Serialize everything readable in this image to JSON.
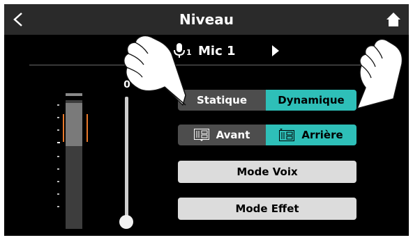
{
  "header": {
    "title": "Niveau",
    "back_icon": "chevron-left-icon",
    "home_icon": "home-icon"
  },
  "channel": {
    "number": "1",
    "label": "Mic 1",
    "icon": "microphone-icon",
    "next_icon": "triangle-right-icon"
  },
  "fader": {
    "value_label": "0",
    "level": 0
  },
  "meter": {
    "icon": "level-meter"
  },
  "mode_toggle": {
    "options": [
      "Statique",
      "Dynamique"
    ],
    "selected": "Dynamique"
  },
  "position_toggle": {
    "options": [
      "Avant",
      "Arrière"
    ],
    "selected": "Arrière",
    "icon": "eq-block-icon"
  },
  "buttons": {
    "voice_mode": "Mode Voix",
    "effect_mode": "Mode Effet"
  },
  "colors": {
    "accent": "#2ebfb8",
    "peak": "#e8782a",
    "header_bg": "#2a2a2a",
    "button_off": "#4d4d4d",
    "button_light": "#dcdcdc"
  }
}
